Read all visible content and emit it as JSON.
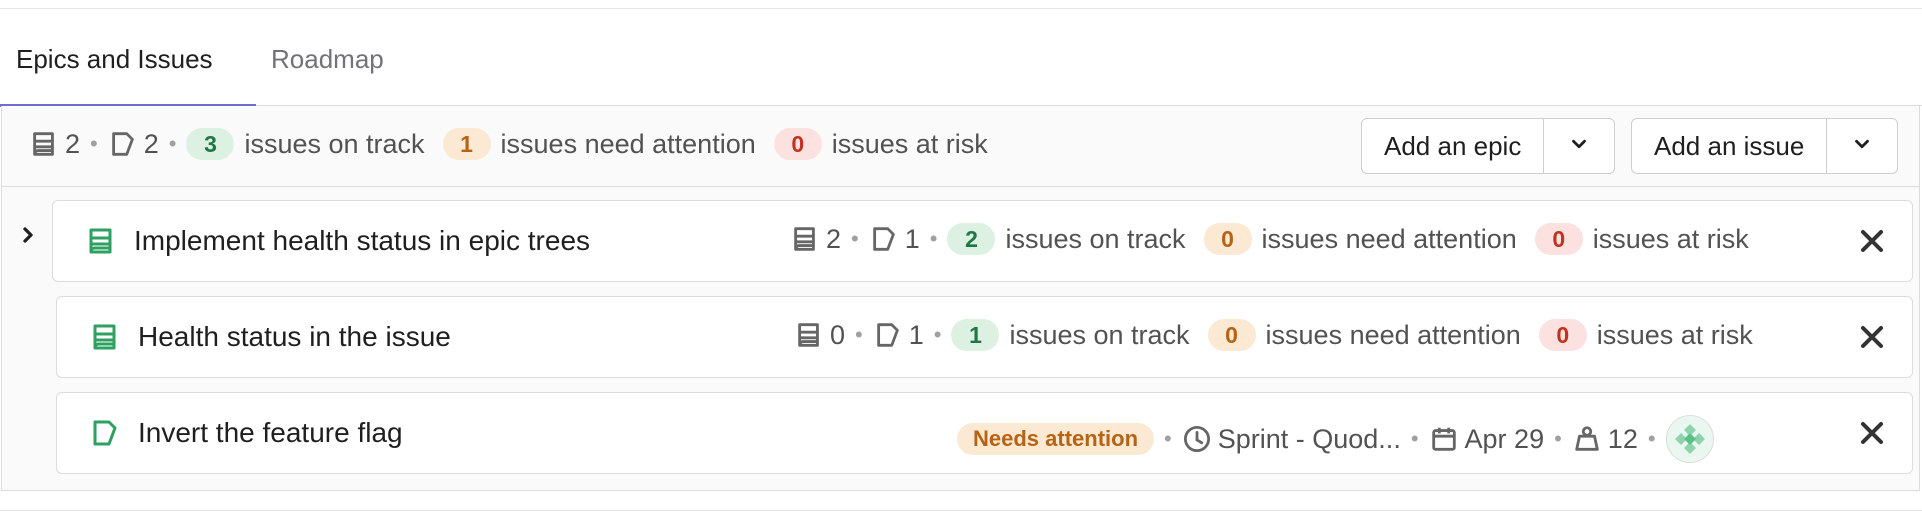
{
  "tabs": [
    {
      "label": "Epics and Issues",
      "active": true
    },
    {
      "label": "Roadmap",
      "active": false
    }
  ],
  "summary": {
    "epic_count": "2",
    "issue_count": "2",
    "on_track_count": "3",
    "on_track_label": "issues on track",
    "attention_count": "1",
    "attention_label": "issues need attention",
    "at_risk_count": "0",
    "at_risk_label": "issues at risk"
  },
  "buttons": {
    "add_epic": "Add an epic",
    "add_issue": "Add an issue"
  },
  "items": [
    {
      "type": "epic",
      "title": "Implement health status in epic trees",
      "epic_count": "2",
      "issue_count": "1",
      "on_track_count": "2",
      "attention_count": "0",
      "at_risk_count": "0"
    },
    {
      "type": "epic",
      "title": "Health status in the issue",
      "epic_count": "0",
      "issue_count": "1",
      "on_track_count": "1",
      "attention_count": "0",
      "at_risk_count": "0"
    },
    {
      "type": "issue",
      "title": "Invert the feature flag",
      "status": "Needs attention",
      "milestone": "Sprint - Quod...",
      "due_date": "Apr 29",
      "weight": "12"
    }
  ],
  "labels": {
    "on_track": "issues on track",
    "attention": "issues need attention",
    "at_risk": "issues at risk"
  },
  "colors": {
    "accent_tab": "#6b6fcf",
    "green": "#217645",
    "orange": "#b86314",
    "red": "#c0341d",
    "epic_icon": "#2da160"
  },
  "icons": {
    "epic": "epic-icon",
    "issue": "issue-icon",
    "close": "close-icon",
    "chevron_down": "chevron-down-icon",
    "chevron_right": "chevron-right-icon",
    "clock": "clock-icon",
    "calendar": "calendar-icon",
    "weight": "weight-icon"
  }
}
